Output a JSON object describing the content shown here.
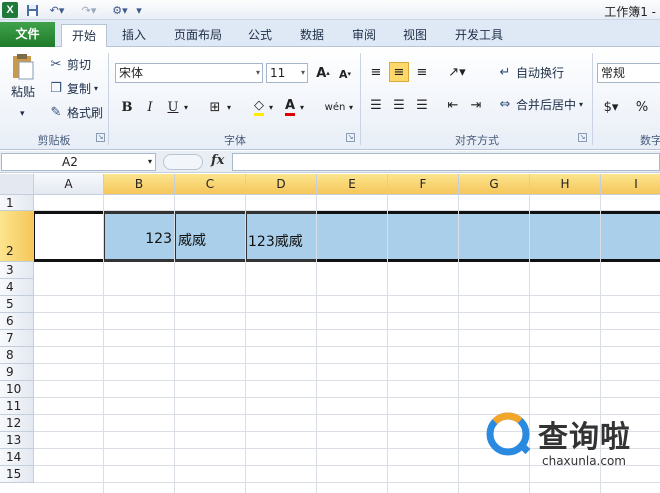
{
  "window": {
    "title": "工作簿1 - "
  },
  "quick_access": {
    "excel_icon": "X",
    "save_icon": "floppy-icon",
    "undo_icon": "undo-icon",
    "redo_icon": "redo-icon",
    "customize_icon": "customize-icon"
  },
  "tabs": [
    {
      "label": "文件"
    },
    {
      "label": "开始"
    },
    {
      "label": "插入"
    },
    {
      "label": "页面布局"
    },
    {
      "label": "公式"
    },
    {
      "label": "数据"
    },
    {
      "label": "审阅"
    },
    {
      "label": "视图"
    },
    {
      "label": "开发工具"
    }
  ],
  "clipboard": {
    "paste": "粘贴",
    "cut": "剪切",
    "copy": "复制",
    "format_painter": "格式刷",
    "group": "剪贴板"
  },
  "font": {
    "name": "宋体",
    "size": "11",
    "grow": "A",
    "shrink": "A",
    "bold": "B",
    "italic": "I",
    "underline": "U",
    "phonetic": "wén",
    "group": "字体"
  },
  "alignment": {
    "wrap": "自动换行",
    "merge": "合并后居中",
    "group": "对齐方式"
  },
  "number": {
    "format": "常规",
    "percent": "%",
    "group": "数字"
  },
  "formula_bar": {
    "name_box": "A2",
    "fx": "fx",
    "formula": ""
  },
  "columns": [
    "A",
    "B",
    "C",
    "D",
    "E",
    "F",
    "G",
    "H",
    "I"
  ],
  "rows": [
    "1",
    "2",
    "3",
    "4",
    "5",
    "6",
    "7",
    "8",
    "9",
    "10",
    "11",
    "12",
    "13",
    "14",
    "15"
  ],
  "cells": {
    "B2": "123",
    "C2": "威威",
    "D2": "123威威"
  },
  "watermark": {
    "brand": "查询啦",
    "url": "chaxunla.com"
  },
  "colors": {
    "accent_selected": "#aacfeb",
    "header_selected": "#f5c65a",
    "file_tab": "#1f7a2b"
  }
}
